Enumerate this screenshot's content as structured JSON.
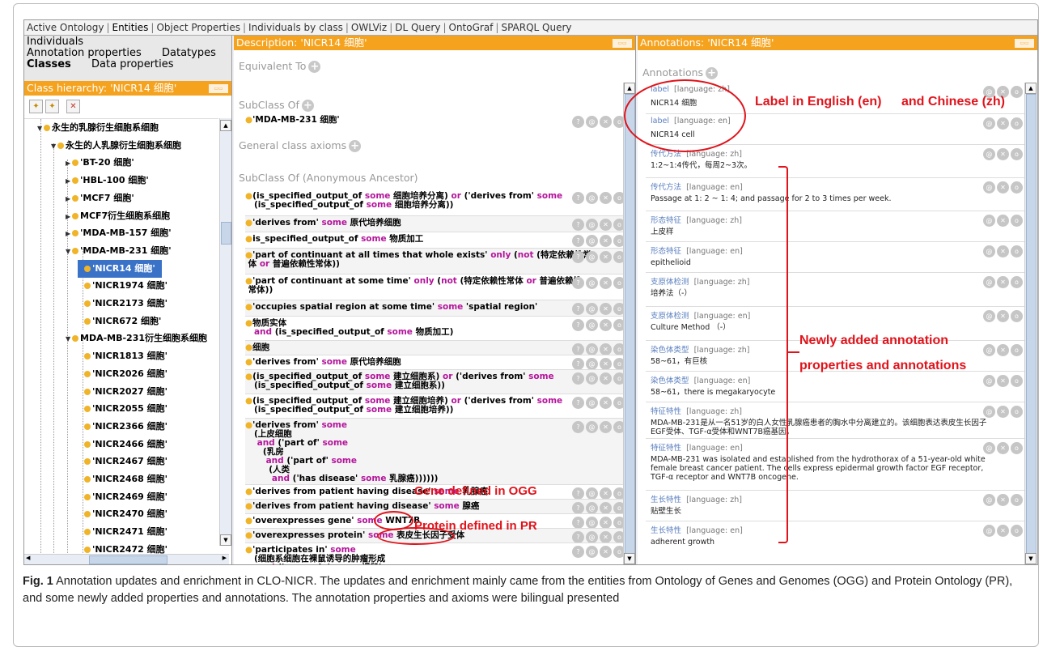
{
  "tabs": [
    "Active Ontology",
    "Entities",
    "Object Properties",
    "Individuals by class",
    "OWLViz",
    "DL Query",
    "OntoGraf",
    "SPARQL Query"
  ],
  "left": {
    "subtabs": [
      "Individuals",
      "Annotation properties",
      "Datatypes",
      "Classes",
      "Data properties"
    ],
    "hierarchy_title": "Class hierarchy: 'NICR14 细胞'",
    "tree": [
      {
        "label": "永生的乳腺衍生细胞系细胞"
      },
      {
        "label": "永生的人乳腺衍生细胞系细胞"
      },
      {
        "label": "'BT-20 细胞'"
      },
      {
        "label": "'HBL-100 细胞'"
      },
      {
        "label": "'MCF7 细胞'"
      },
      {
        "label": "MCF7衍生细胞系细胞"
      },
      {
        "label": "'MDA-MB-157 细胞'"
      },
      {
        "label": "'MDA-MB-231 细胞'"
      },
      {
        "label": "'NICR14 细胞'"
      },
      {
        "label": "'NICR1974 细胞'"
      },
      {
        "label": "'NICR2173 细胞'"
      },
      {
        "label": "'NICR672 细胞'"
      },
      {
        "label": "MDA-MB-231衍生细胞系细胞"
      },
      {
        "label": "'NICR1813 细胞'"
      },
      {
        "label": "'NICR2026 细胞'"
      },
      {
        "label": "'NICR2027 细胞'"
      },
      {
        "label": "'NICR2055 细胞'"
      },
      {
        "label": "'NICR2366 细胞'"
      },
      {
        "label": "'NICR2466 细胞'"
      },
      {
        "label": "'NICR2467 细胞'"
      },
      {
        "label": "'NICR2468 细胞'"
      },
      {
        "label": "'NICR2469 细胞'"
      },
      {
        "label": "'NICR2470 细胞'"
      },
      {
        "label": "'NICR2471 细胞'"
      },
      {
        "label": "'NICR2472 细胞'"
      }
    ]
  },
  "mid": {
    "title": "Description: 'NICR14 细胞'",
    "equivalent_to": "Equivalent To",
    "subclass_of": "SubClass Of",
    "subclass_item": "'MDA-MB-231 细胞'",
    "general_axioms": "General class axioms",
    "anon_ancestor": "SubClass Of (Anonymous Ancestor)"
  },
  "right": {
    "title": "Annotations: 'NICR14 细胞'",
    "annotations_header": "Annotations",
    "items": [
      {
        "key": "label",
        "lang": "[language: zh]",
        "value": "NICR14 细胞"
      },
      {
        "key": "label",
        "lang": "[language: en]",
        "value": "NICR14 cell"
      },
      {
        "key": "传代方法",
        "lang": "[language: zh]",
        "value": "1:2~1:4传代，每周2~3次。"
      },
      {
        "key": "传代方法",
        "lang": "[language: en]",
        "value": "Passage at 1: 2 ~ 1: 4; and passage for 2 to 3 times per week."
      },
      {
        "key": "形态特征",
        "lang": "[language: zh]",
        "value": "上皮样"
      },
      {
        "key": "形态特征",
        "lang": "[language: en]",
        "value": "epithelioid"
      },
      {
        "key": "支原体检测",
        "lang": "[language: zh]",
        "value": "培养法（-）"
      },
      {
        "key": "支原体检测",
        "lang": "[language: en]",
        "value": "Culture Method （-）"
      },
      {
        "key": "染色体类型",
        "lang": "[language: zh]",
        "value": "58~61，有巨核"
      },
      {
        "key": "染色体类型",
        "lang": "[language: en]",
        "value": "58~61，there is megakaryocyte"
      },
      {
        "key": "特征特性",
        "lang": "[language: zh]",
        "value": "MDA-MB-231是从一名51岁的白人女性乳腺癌患者的胸水中分离建立的。该细胞表达表皮生长因子EGF受体、TGF-α受体和WNT7B癌基因。"
      },
      {
        "key": "特征特性",
        "lang": "[language: en]",
        "value": "MDA-MB-231 was isolated and established from the hydrothorax of a 51-year-old white female breast cancer patient. The cells express epidermal growth factor EGF receptor, TGF-α receptor and WNT7B oncogene."
      },
      {
        "key": "生长特性",
        "lang": "[language: zh]",
        "value": "贴壁生长"
      },
      {
        "key": "生长特性",
        "lang": "[language: en]",
        "value": "adherent growth"
      }
    ]
  },
  "callouts": {
    "label_en": "Label in English (en)",
    "label_zh": "and Chinese (zh)",
    "newly_1": "Newly added annotation",
    "newly_2": "properties and annotations",
    "gene": "Gene defined in OGG",
    "protein": "Protein defined in PR"
  },
  "caption": {
    "fig": "Fig. 1",
    "text": " Annotation updates and enrichment in CLO-NICR. The updates and enrichment mainly came from the entities from Ontology of Genes and Genomes (OGG) and Protein Ontology (PR), and some newly added properties and annotations. The annotation properties and axioms were bilingual presented"
  }
}
